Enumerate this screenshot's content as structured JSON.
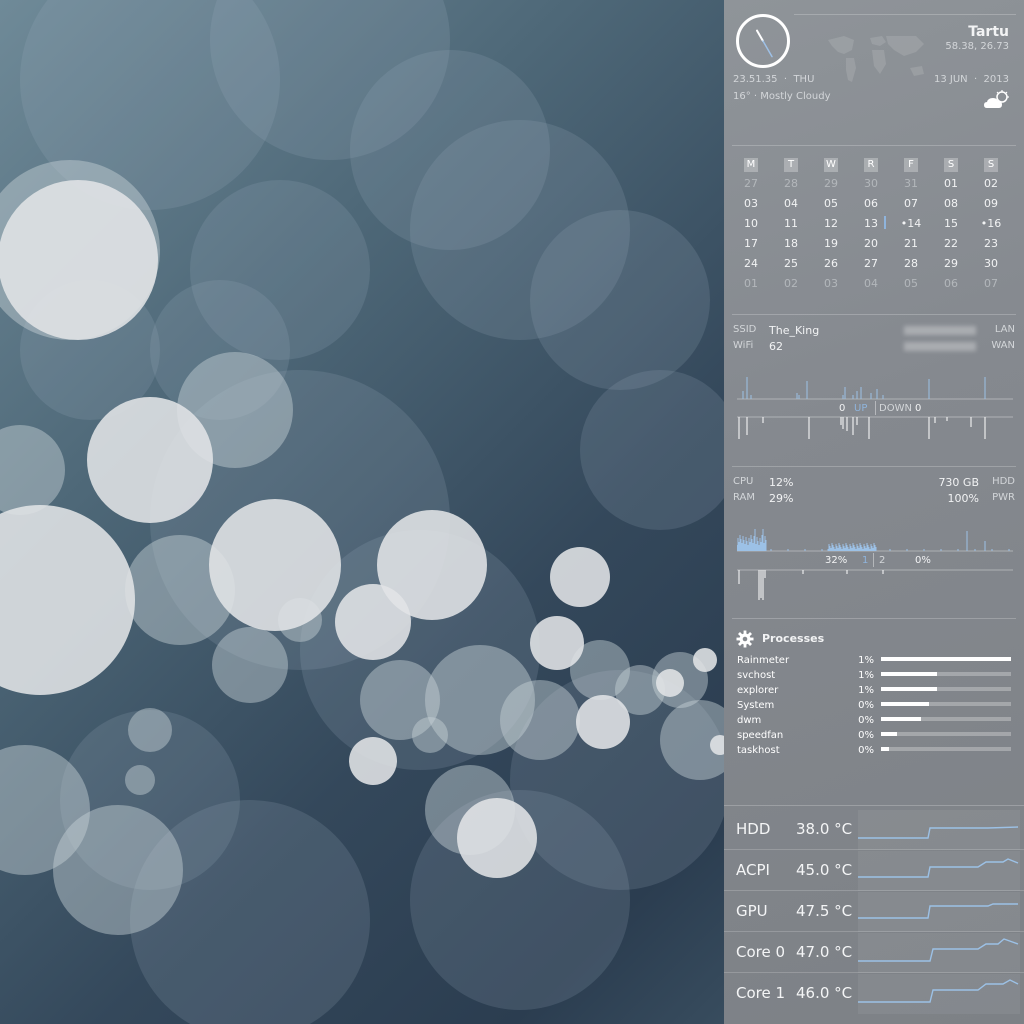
{
  "clock": {
    "hour_hand_deg": 330,
    "minute_hand_deg": 150
  },
  "location": {
    "city": "Tartu",
    "coords": "58.38, 26.73"
  },
  "time": {
    "display": "23.51.35",
    "day": "THU",
    "date": "13 JUN",
    "year": "2013"
  },
  "weather": {
    "text": "16° · Mostly Cloudy",
    "icon": "cloud-sun-icon"
  },
  "calendar": {
    "weekdays": [
      "M",
      "T",
      "W",
      "R",
      "F",
      "S",
      "S"
    ],
    "rows": [
      [
        "27",
        "28",
        "29",
        "30",
        "31",
        "01",
        "02"
      ],
      [
        "03",
        "04",
        "05",
        "06",
        "07",
        "08",
        "09"
      ],
      [
        "10",
        "11",
        "12",
        "13",
        "•14",
        "15",
        "•16"
      ],
      [
        "17",
        "18",
        "19",
        "20",
        "21",
        "22",
        "23"
      ],
      [
        "24",
        "25",
        "26",
        "27",
        "28",
        "29",
        "30"
      ],
      [
        "01",
        "02",
        "03",
        "04",
        "05",
        "06",
        "07"
      ]
    ],
    "other_month": [
      [
        0,
        0
      ],
      [
        0,
        1
      ],
      [
        0,
        2
      ],
      [
        0,
        3
      ],
      [
        0,
        4
      ],
      [
        5,
        0
      ],
      [
        5,
        1
      ],
      [
        5,
        2
      ],
      [
        5,
        3
      ],
      [
        5,
        4
      ],
      [
        5,
        5
      ],
      [
        5,
        6
      ]
    ],
    "today": [
      2,
      3
    ]
  },
  "network": {
    "ssid_label": "SSID",
    "ssid": "The_King",
    "wifi_label": "WiFi",
    "wifi": "62",
    "lan_label": "LAN",
    "wan_label": "WAN",
    "up_value": "0",
    "up_label": "UP",
    "down_label": "DOWN",
    "down_value": "0"
  },
  "system": {
    "cpu_label": "CPU",
    "cpu": "12%",
    "ram_label": "RAM",
    "ram": "29%",
    "hdd": "730 GB",
    "hdd_label": "HDD",
    "pwr": "100%",
    "pwr_label": "PWR",
    "core1_pct": "32%",
    "core1_label": "1",
    "core2_label": "2",
    "core2_pct": "0%"
  },
  "processes": {
    "title": "Processes",
    "items": [
      {
        "name": "Rainmeter",
        "pct": "1%",
        "bar": 1.0
      },
      {
        "name": "svchost",
        "pct": "1%",
        "bar": 0.43
      },
      {
        "name": "explorer",
        "pct": "1%",
        "bar": 0.43
      },
      {
        "name": "System",
        "pct": "0%",
        "bar": 0.37
      },
      {
        "name": "dwm",
        "pct": "0%",
        "bar": 0.31
      },
      {
        "name": "speedfan",
        "pct": "0%",
        "bar": 0.12
      },
      {
        "name": "taskhost",
        "pct": "0%",
        "bar": 0.06
      }
    ]
  },
  "temps": [
    {
      "label": "HDD",
      "value": "38.0 °C"
    },
    {
      "label": "ACPI",
      "value": "45.0 °C"
    },
    {
      "label": "GPU",
      "value": "47.5 °C"
    },
    {
      "label": "Core 0",
      "value": "47.0 °C"
    },
    {
      "label": "Core 1",
      "value": "46.0 °C"
    }
  ],
  "colors": {
    "accent_blue": "#8fb4dc",
    "graph_line": "#9cc1e6"
  }
}
